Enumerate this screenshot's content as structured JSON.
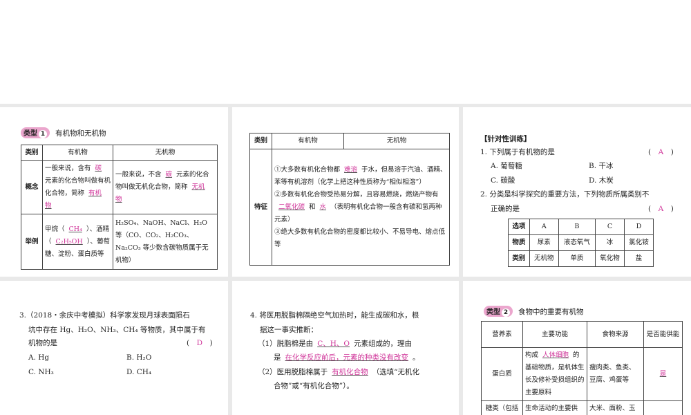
{
  "type1": {
    "badge": "类型",
    "num": "1",
    "title": "有机物和无机物",
    "headers": [
      "类别",
      "有机物",
      "无机物"
    ],
    "concept_label": "概念",
    "concept_org_pre": "一般来说，含有",
    "concept_org_ans1": "碳",
    "concept_org_mid": "元素的化合物叫做有机化合物，简称",
    "concept_org_ans2": "有机物",
    "concept_inorg_pre": "一般来说，不含",
    "concept_inorg_ans1": "碳",
    "concept_inorg_mid": "元素的化合物叫做无机化合物，简称",
    "concept_inorg_ans2": "无机物",
    "example_label": "举例",
    "ex_org_1": "甲烷（",
    "ex_org_ans1": "CH₄",
    "ex_org_2": "）、酒精（",
    "ex_org_ans2": "C₂H₅OH",
    "ex_org_3": "）、葡萄糖、淀粉、蛋白质等",
    "ex_inorg": "H₂SO₄、NaOH、NaCl、H₂O 等（CO、CO₂、H₂CO₃、Na₂CO₃ 等少数含碳物质属于无机物）"
  },
  "features": {
    "headers": [
      "类别",
      "有机物",
      "无机物"
    ],
    "label": "特征",
    "f1_pre": "①大多数有机化合物都",
    "f1_ans": "难溶",
    "f1_post": "于水，但易溶于汽油、酒精、苯等有机溶剂（化学上把这种性质称为“相似相溶”）",
    "f2_pre": "②多数有机化合物受热易分解，且容易燃烧，燃烧产物有",
    "f2_ans1": "二氧化碳",
    "f2_mid": "和",
    "f2_ans2": "水",
    "f2_post": "（表明有机化合物一般含有碳和氢两种元素）",
    "f3": "③绝大多数有机化合物的密度都比较小、不易导电、熔点低等"
  },
  "training": {
    "title": "【针对性训练】",
    "q1": "1. 下列属于有机物的是",
    "q1_ans": "A",
    "q1_opts": [
      "A. 葡萄糖",
      "B. 干冰",
      "C. 碳酸",
      "D. 木炭"
    ],
    "q2a": "2. 分类是科学探究的重要方法，下列物质所属类别不",
    "q2b": "正确的是",
    "q2_ans": "A",
    "table": [
      [
        "选项",
        "A",
        "B",
        "C",
        "D"
      ],
      [
        "物质",
        "尿素",
        "液态氧气",
        "冰",
        "氯化铵"
      ],
      [
        "类别",
        "无机物",
        "单质",
        "氧化物",
        "盐"
      ]
    ]
  },
  "q3": {
    "l1": "3.（2018・余庆中考模拟）科学家发现月球表面陨石",
    "l2": "坑中存在 Hg、H₂O、NH₃、CH₄ 等物质，其中属于有",
    "l3": "机物的是",
    "ans": "D",
    "opts": [
      "A. Hg",
      "B. H₂O",
      "C. NH₃",
      "D. CH₄"
    ]
  },
  "q4": {
    "l1": "4. 将医用脱脂棉隔绝空气加热时，能生成碳和水，根",
    "l2": "据这一事实推断：",
    "p1_pre": "（1）脱脂棉是由",
    "p1_ans": "C、H、O",
    "p1_post": "元素组成的，理由",
    "p1b_pre": "是",
    "p1b_ans": "在化学反应前后，元素的种类没有改变",
    "p1b_post": "。",
    "p2_pre": "（2）医用脱脂棉属于",
    "p2_ans": "有机化合物",
    "p2_post": "（选填“无机化",
    "p2b": "合物”或“有机化合物”）。"
  },
  "type2": {
    "badge": "类型",
    "num": "2",
    "title": "食物中的重要有机物",
    "headers": [
      "营养素",
      "主要功能",
      "食物来源",
      "是否能供能"
    ],
    "r1": {
      "name": "蛋白质",
      "func_pre": "构成",
      "func_ans": "人体细胞",
      "func_post": "的基础物质，是机体生长及修补受损组织的主要原料",
      "source": "瘦肉类、鱼类、豆腐、鸡蛋等",
      "energy": "是"
    },
    "r2": {
      "name": "糖类（包括",
      "func": "生命活动的主要供",
      "source": "大米、面粉、玉"
    }
  }
}
